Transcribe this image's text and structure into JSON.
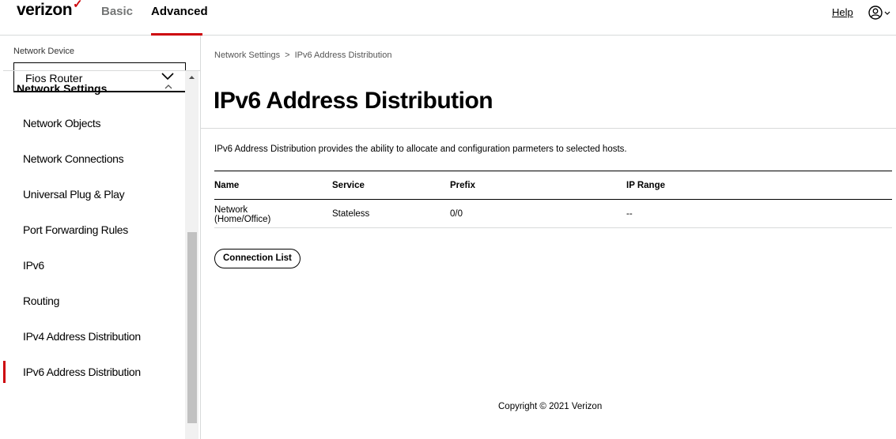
{
  "header": {
    "logo_text": "verizon",
    "logo_mark": "✓",
    "tabs": [
      {
        "label": "Basic",
        "active": false
      },
      {
        "label": "Advanced",
        "active": true
      }
    ],
    "help_label": "Help",
    "account_icon": "user-circle-icon",
    "accent_color": "#cd040b"
  },
  "sidebar": {
    "device_label": "Network Device",
    "device_selected": "Fios Router",
    "section_title": "Network Settings",
    "items": [
      {
        "label": "Network Objects"
      },
      {
        "label": "Network Connections"
      },
      {
        "label": "Universal Plug & Play"
      },
      {
        "label": "Port Forwarding Rules"
      },
      {
        "label": "IPv6"
      },
      {
        "label": "Routing"
      },
      {
        "label": "IPv4 Address Distribution"
      },
      {
        "label": "IPv6 Address Distribution",
        "active": true
      }
    ]
  },
  "main": {
    "breadcrumb": [
      "Network Settings",
      "IPv6 Address Distribution"
    ],
    "breadcrumb_sep": ">",
    "title": "IPv6 Address Distribution",
    "description": "IPv6 Address Distribution provides the ability to allocate and configuration parmeters to selected hosts.",
    "table": {
      "columns": [
        "Name",
        "Service",
        "Prefix",
        "IP Range"
      ],
      "rows": [
        {
          "name_line1": "Network",
          "name_line2": "(Home/Office)",
          "service": "Stateless",
          "prefix": "0/0",
          "ip_range": "--"
        }
      ]
    },
    "connection_list_label": "Connection List"
  },
  "footer": {
    "copyright": "Copyright © 2021 Verizon"
  }
}
